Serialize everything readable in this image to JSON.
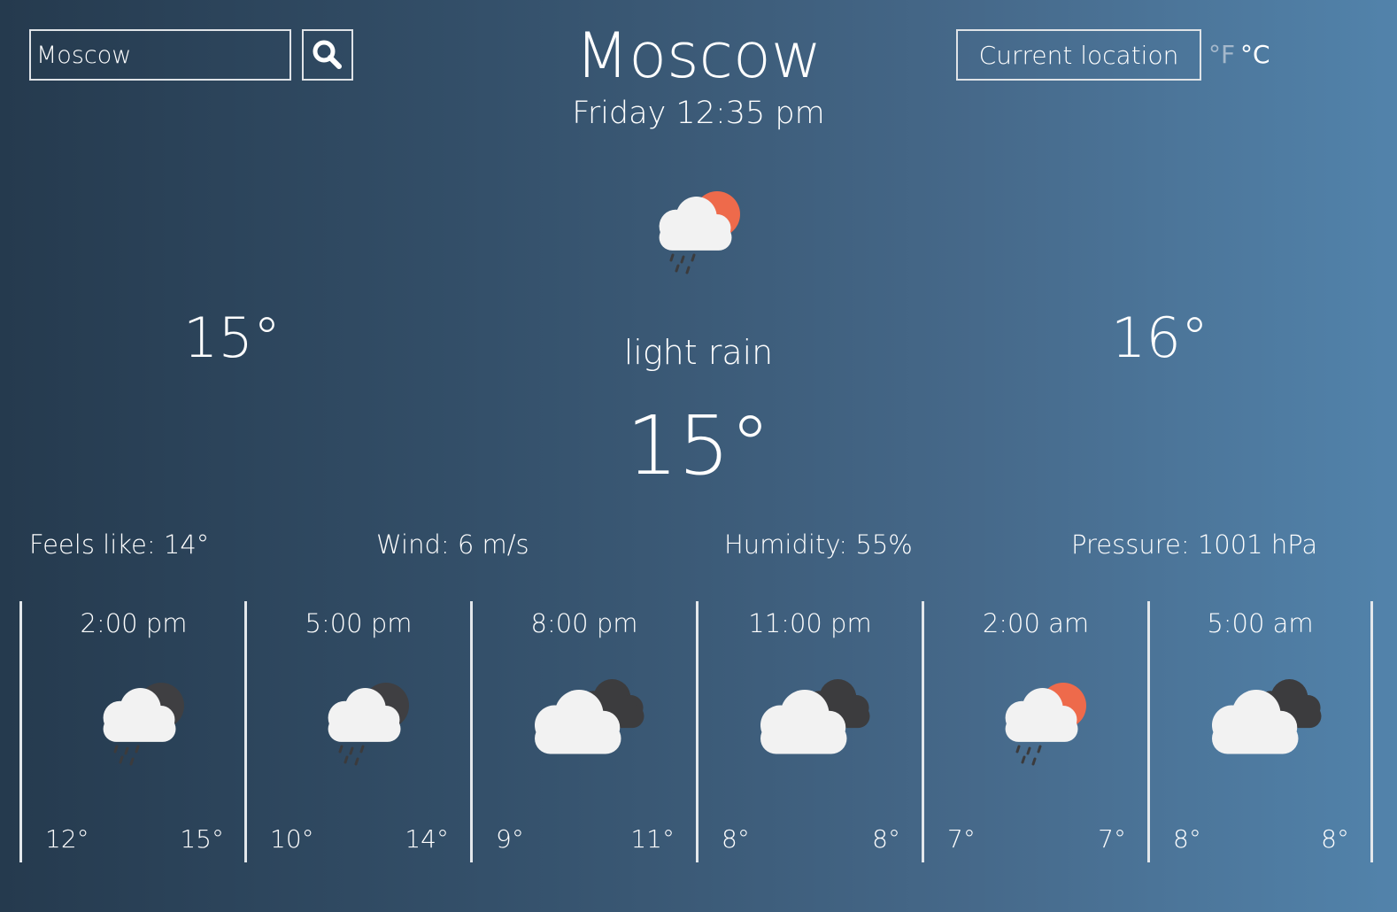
{
  "search": {
    "value": "Moscow",
    "button_icon": "search-icon"
  },
  "header": {
    "city": "Moscow",
    "datetime": "Friday 12:35 pm",
    "current_location_label": "Current location",
    "unit_f": "°F",
    "unit_c": "°C",
    "active_unit": "C"
  },
  "current": {
    "icon": "cloud-rain-sun-icon",
    "temp_min": "15°",
    "temp_max": "16°",
    "description": "light rain",
    "temp": "15°"
  },
  "stats": {
    "feels_like": "Feels like: 14°",
    "wind": "Wind: 6 m/s",
    "humidity": "Humidity: 55%",
    "pressure": "Pressure: 1001 hPa"
  },
  "forecast": [
    {
      "time": "2:00 pm",
      "icon": "cloud-rain-moon-icon",
      "lo": "12°",
      "hi": "15°"
    },
    {
      "time": "5:00 pm",
      "icon": "cloud-rain-moon-icon",
      "lo": "10°",
      "hi": "14°"
    },
    {
      "time": "8:00 pm",
      "icon": "broken-clouds-icon",
      "lo": "9°",
      "hi": "11°"
    },
    {
      "time": "11:00 pm",
      "icon": "broken-clouds-icon",
      "lo": "8°",
      "hi": "8°"
    },
    {
      "time": "2:00 am",
      "icon": "cloud-rain-sun-icon",
      "lo": "7°",
      "hi": "7°"
    },
    {
      "time": "5:00 am",
      "icon": "broken-clouds-icon",
      "lo": "8°",
      "hi": "8°"
    }
  ],
  "colors": {
    "sun": "#ee6a4b",
    "moon": "#3f3f42",
    "cloud": "#f2f2f2",
    "dark_cloud": "#3c3c3e",
    "rain": "#3b3b3d",
    "border": "#dfe3e7",
    "inactive_unit": "#a5b8cb"
  }
}
